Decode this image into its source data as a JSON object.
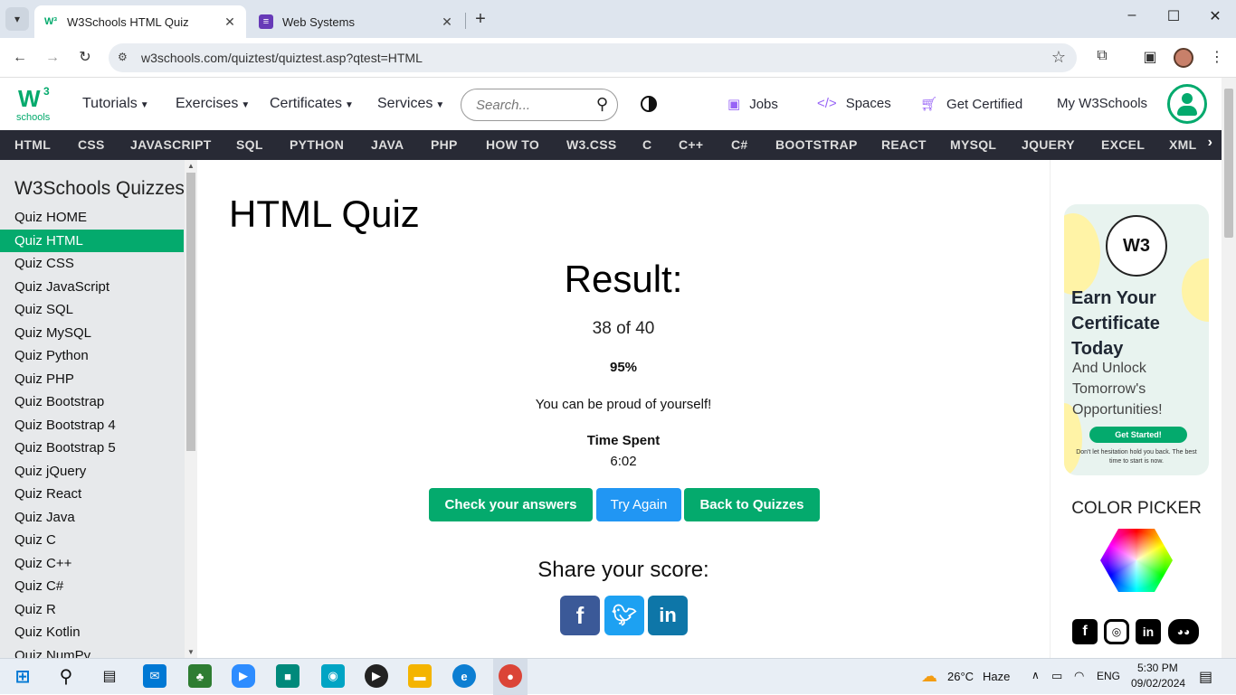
{
  "browser": {
    "tabs": [
      {
        "title": "W3Schools HTML Quiz",
        "active": true,
        "favicon": "w3"
      },
      {
        "title": "Web Systems",
        "active": false,
        "favicon": "form-icon"
      }
    ],
    "url": "w3schools.com/quiztest/quiztest.asp?qtest=HTML",
    "new_tab": "+",
    "minimize": "–",
    "maximize": "☐",
    "close": "✕"
  },
  "header": {
    "logo_text": "W",
    "logo_sup": "3",
    "logo_sub": "schools",
    "menu": [
      "Tutorials",
      "Exercises",
      "Certificates",
      "Services"
    ],
    "search_placeholder": "Search...",
    "links": [
      "Jobs",
      "Spaces",
      "Get Certified"
    ],
    "my_account": "My W3Schools"
  },
  "subnav": [
    "HTML",
    "CSS",
    "JAVASCRIPT",
    "SQL",
    "PYTHON",
    "JAVA",
    "PHP",
    "HOW TO",
    "W3.CSS",
    "C",
    "C++",
    "C#",
    "BOOTSTRAP",
    "REACT",
    "MYSQL",
    "JQUERY",
    "EXCEL",
    "XML"
  ],
  "sidebar": {
    "heading": "W3Schools Quizzes",
    "items": [
      "Quiz HOME",
      "Quiz HTML",
      "Quiz CSS",
      "Quiz JavaScript",
      "Quiz SQL",
      "Quiz MySQL",
      "Quiz Python",
      "Quiz PHP",
      "Quiz Bootstrap",
      "Quiz Bootstrap 4",
      "Quiz Bootstrap 5",
      "Quiz jQuery",
      "Quiz React",
      "Quiz Java",
      "Quiz C",
      "Quiz C++",
      "Quiz C#",
      "Quiz R",
      "Quiz Kotlin",
      "Quiz NumPy"
    ],
    "active_index": 1
  },
  "main": {
    "title": "HTML Quiz",
    "result_heading": "Result:",
    "score": "38 of 40",
    "percent": "95%",
    "message": "You can be proud of yourself!",
    "time_label": "Time Spent",
    "time_value": "6:02",
    "buttons": {
      "check": "Check your answers",
      "try_again": "Try Again",
      "back": "Back to Quizzes"
    },
    "share_heading": "Share your score:"
  },
  "ad": {
    "seal": "W3",
    "headline": "Earn Your Certificate Today",
    "subline": "And Unlock Tomorrow's Opportunities!",
    "cta": "Get Started!",
    "small_print": "Don't let hesitation hold you back. The best time to start is now."
  },
  "color_picker": {
    "title": "COLOR PICKER"
  },
  "taskbar": {
    "weather_temp": "26°C",
    "weather_desc": "Haze",
    "language": "ENG",
    "time": "5:30 PM",
    "date": "09/02/2024"
  },
  "colors": {
    "brand_green": "#04aa6d",
    "dark_nav": "#282a35",
    "blue_button": "#2196f3"
  }
}
